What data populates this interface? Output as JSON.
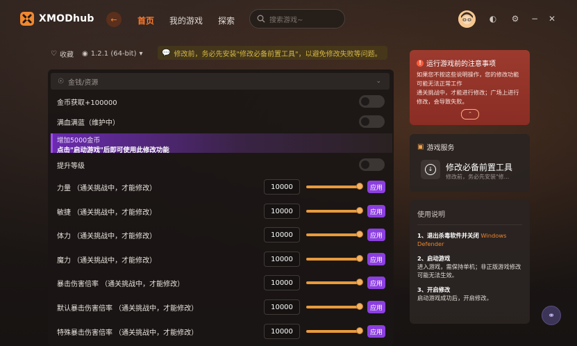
{
  "app": {
    "name": "XMODhub"
  },
  "nav": {
    "items": [
      "首页",
      "我的游戏",
      "探索"
    ],
    "active": "首页"
  },
  "search": {
    "placeholder": "搜索游戏~"
  },
  "info": {
    "favorite_label": "收藏",
    "version": "1.2.1 (64-bit)",
    "notice": "修改前，务必先安装\"修改必备前置工具\"，以避免修改失败等问题。"
  },
  "section": {
    "title": "金钱/资源"
  },
  "toggles": [
    {
      "label": "金币获取+100000",
      "on": false
    },
    {
      "label": "满血满蓝（维护中）",
      "on": false
    }
  ],
  "banner": {
    "line1": "增加5000金币",
    "line2": "点击\"启动游戏\"后即可使用此修改功能"
  },
  "level_toggle": {
    "label": "提升等级",
    "on": false
  },
  "sliders": [
    {
      "label": "力量 （通关挑战中，才能修改）",
      "value": "10000",
      "level": 1.0,
      "apply": "应用"
    },
    {
      "label": "敏捷 （通关挑战中，才能修改）",
      "value": "10000",
      "level": 1.0,
      "apply": "应用"
    },
    {
      "label": "体力 （通关挑战中，才能修改）",
      "value": "10000",
      "level": 1.0,
      "apply": "应用"
    },
    {
      "label": "魔力 （通关挑战中，才能修改）",
      "value": "10000",
      "level": 1.0,
      "apply": "应用"
    },
    {
      "label": "暴击伤害倍率 （通关挑战中，才能修改）",
      "value": "10000",
      "level": 1.0,
      "apply": "应用"
    },
    {
      "label": "默认暴击伤害倍率 （通关挑战中，才能修改）",
      "value": "10000",
      "level": 1.0,
      "apply": "应用"
    },
    {
      "label": "特殊暴击伤害倍率 （通关挑战中，才能修改）",
      "value": "10000",
      "level": 1.0,
      "apply": "应用"
    }
  ],
  "warning": {
    "title": "运行游戏前的注意事项",
    "body_line1": "如果您不按这些说明操作，您的修改功能可能无法正常工作",
    "body_line2": "通关挑战中，才能进行修改；广场上进行修改，会导致失败。"
  },
  "service": {
    "header": "游戏服务",
    "title": "修改必备前置工具",
    "subtitle": "修改前，务必先安装\"修..."
  },
  "guide": {
    "title": "使用说明",
    "steps": [
      {
        "head": "1、退出杀毒软件并关闭",
        "highlight": "Windows Defender",
        "body": ""
      },
      {
        "head": "2、启动游戏",
        "highlight": "",
        "body": "进入游戏，需保持单机；非正版游戏修改可能无法生效。"
      },
      {
        "head": "3、开启修改",
        "highlight": "",
        "body": "启动游戏成功后，开启修改。"
      }
    ]
  },
  "colors": {
    "accent": "#ff7a2a",
    "apply": "#8c3fe0",
    "slider": "#e89a3c",
    "warning_bg": "#9c3a2e"
  },
  "icons": [
    "logo-icon",
    "back-arrow-icon",
    "search-icon",
    "heart-icon",
    "steam-icon",
    "chat-icon",
    "coin-icon",
    "warning-icon",
    "chevron-up-icon",
    "cube-icon",
    "download-icon",
    "headset-icon",
    "minimize-icon",
    "close-icon",
    "settings-icon",
    "theme-icon"
  ]
}
